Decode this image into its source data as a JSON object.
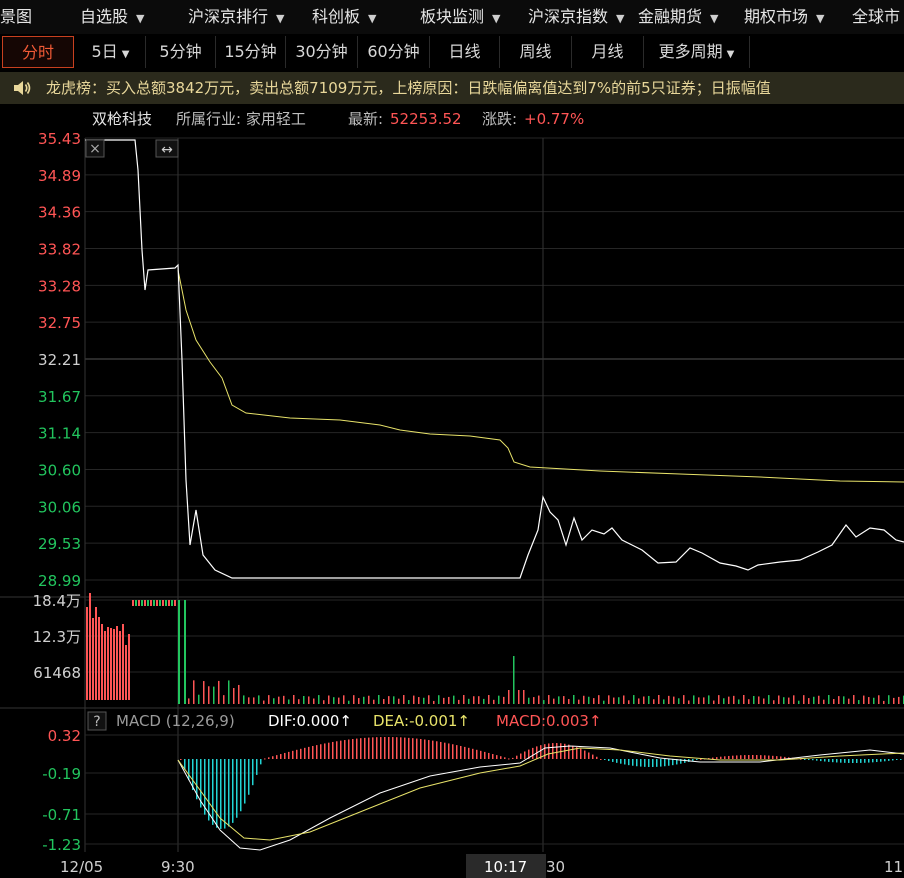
{
  "nav": [
    "景图",
    "自选股",
    "沪深京排行",
    "科创板",
    "板块监测",
    "沪深京指数",
    "金融期货",
    "期权市场",
    "全球市"
  ],
  "periods": [
    "分时",
    "5日",
    "5分钟",
    "15分钟",
    "30分钟",
    "60分钟",
    "日线",
    "周线",
    "月线",
    "更多周期"
  ],
  "ticker_text": "龙虎榜：买入总额3842万元，卖出总额7109万元，上榜原因：日跌幅偏离值达到7%的前5只证券；日振幅值",
  "stock": {
    "name": "双枪科技",
    "industry": "所属行业: 家用轻工",
    "latest_label": "最新:",
    "latest_value": "52253.52",
    "change_label": "涨跌:",
    "change_value": "+0.77%"
  },
  "price_axis": [
    "35.43",
    "34.89",
    "34.36",
    "33.82",
    "33.28",
    "32.75",
    "32.21",
    "31.67",
    "31.14",
    "30.60",
    "30.06",
    "29.53",
    "28.99"
  ],
  "volume_axis": [
    "18.4万",
    "12.3万",
    "61468"
  ],
  "macd_axis": [
    "0.32",
    "-0.19",
    "-0.71",
    "-1.23"
  ],
  "macd": {
    "help": "?",
    "name": "MACD (12,26,9)",
    "dif": "DIF:0.000↑",
    "dea": "DEA:-0.001↑",
    "macd": "MACD:0.003↑"
  },
  "time_axis": [
    "12/05",
    "9:30",
    "10:17",
    "30",
    "11"
  ],
  "chart_close_icon": "×",
  "chart_expand_icon": "↔",
  "colors": {
    "up": "#ff5555",
    "down": "#22c55e",
    "avg": "#e8e36a",
    "price": "#ffffff",
    "accent": "#f05a36"
  }
}
